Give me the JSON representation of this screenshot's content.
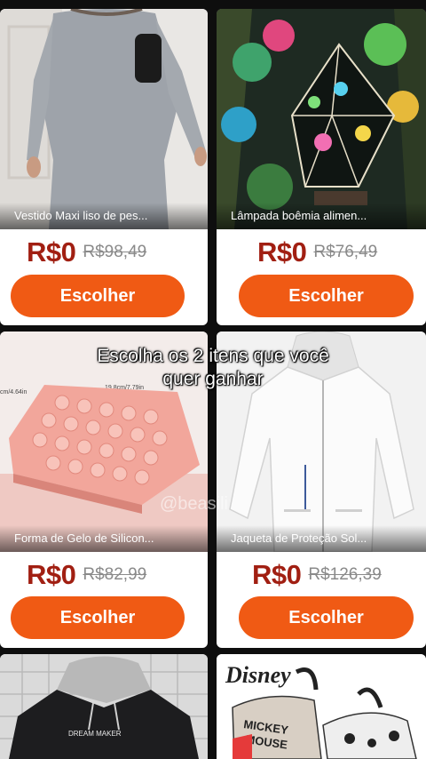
{
  "overlay": {
    "line1": "Escolha os 2 itens que você",
    "line2": "quer ganhar"
  },
  "watermark": "@beasili",
  "products": [
    {
      "title": "Vestido Maxi liso de pes...",
      "price": "R$0",
      "old_price": "R$98,49",
      "button": "Escolher"
    },
    {
      "title": "Lâmpada boêmia alimen...",
      "price": "R$0",
      "old_price": "R$76,49",
      "button": "Escolher"
    },
    {
      "title": "Forma de Gelo de Silicon...",
      "price": "R$0",
      "old_price": "R$82,99",
      "button": "Escolher"
    },
    {
      "title": "Jaqueta de Proteção Sol...",
      "price": "R$0",
      "old_price": "R$126,39",
      "button": "Escolher"
    }
  ],
  "partial_products": [
    {
      "image_text": "DREAM MAKER"
    },
    {
      "brand": "Disney",
      "image_text_1": "MICKEY",
      "image_text_2": "MOUSE"
    }
  ],
  "ice_tray_dims": [
    "19.8cm/7.79in",
    "cm/4.64in"
  ],
  "colors": {
    "accent": "#f05a14",
    "price": "#a11f12",
    "background": "#0e0e0e"
  }
}
